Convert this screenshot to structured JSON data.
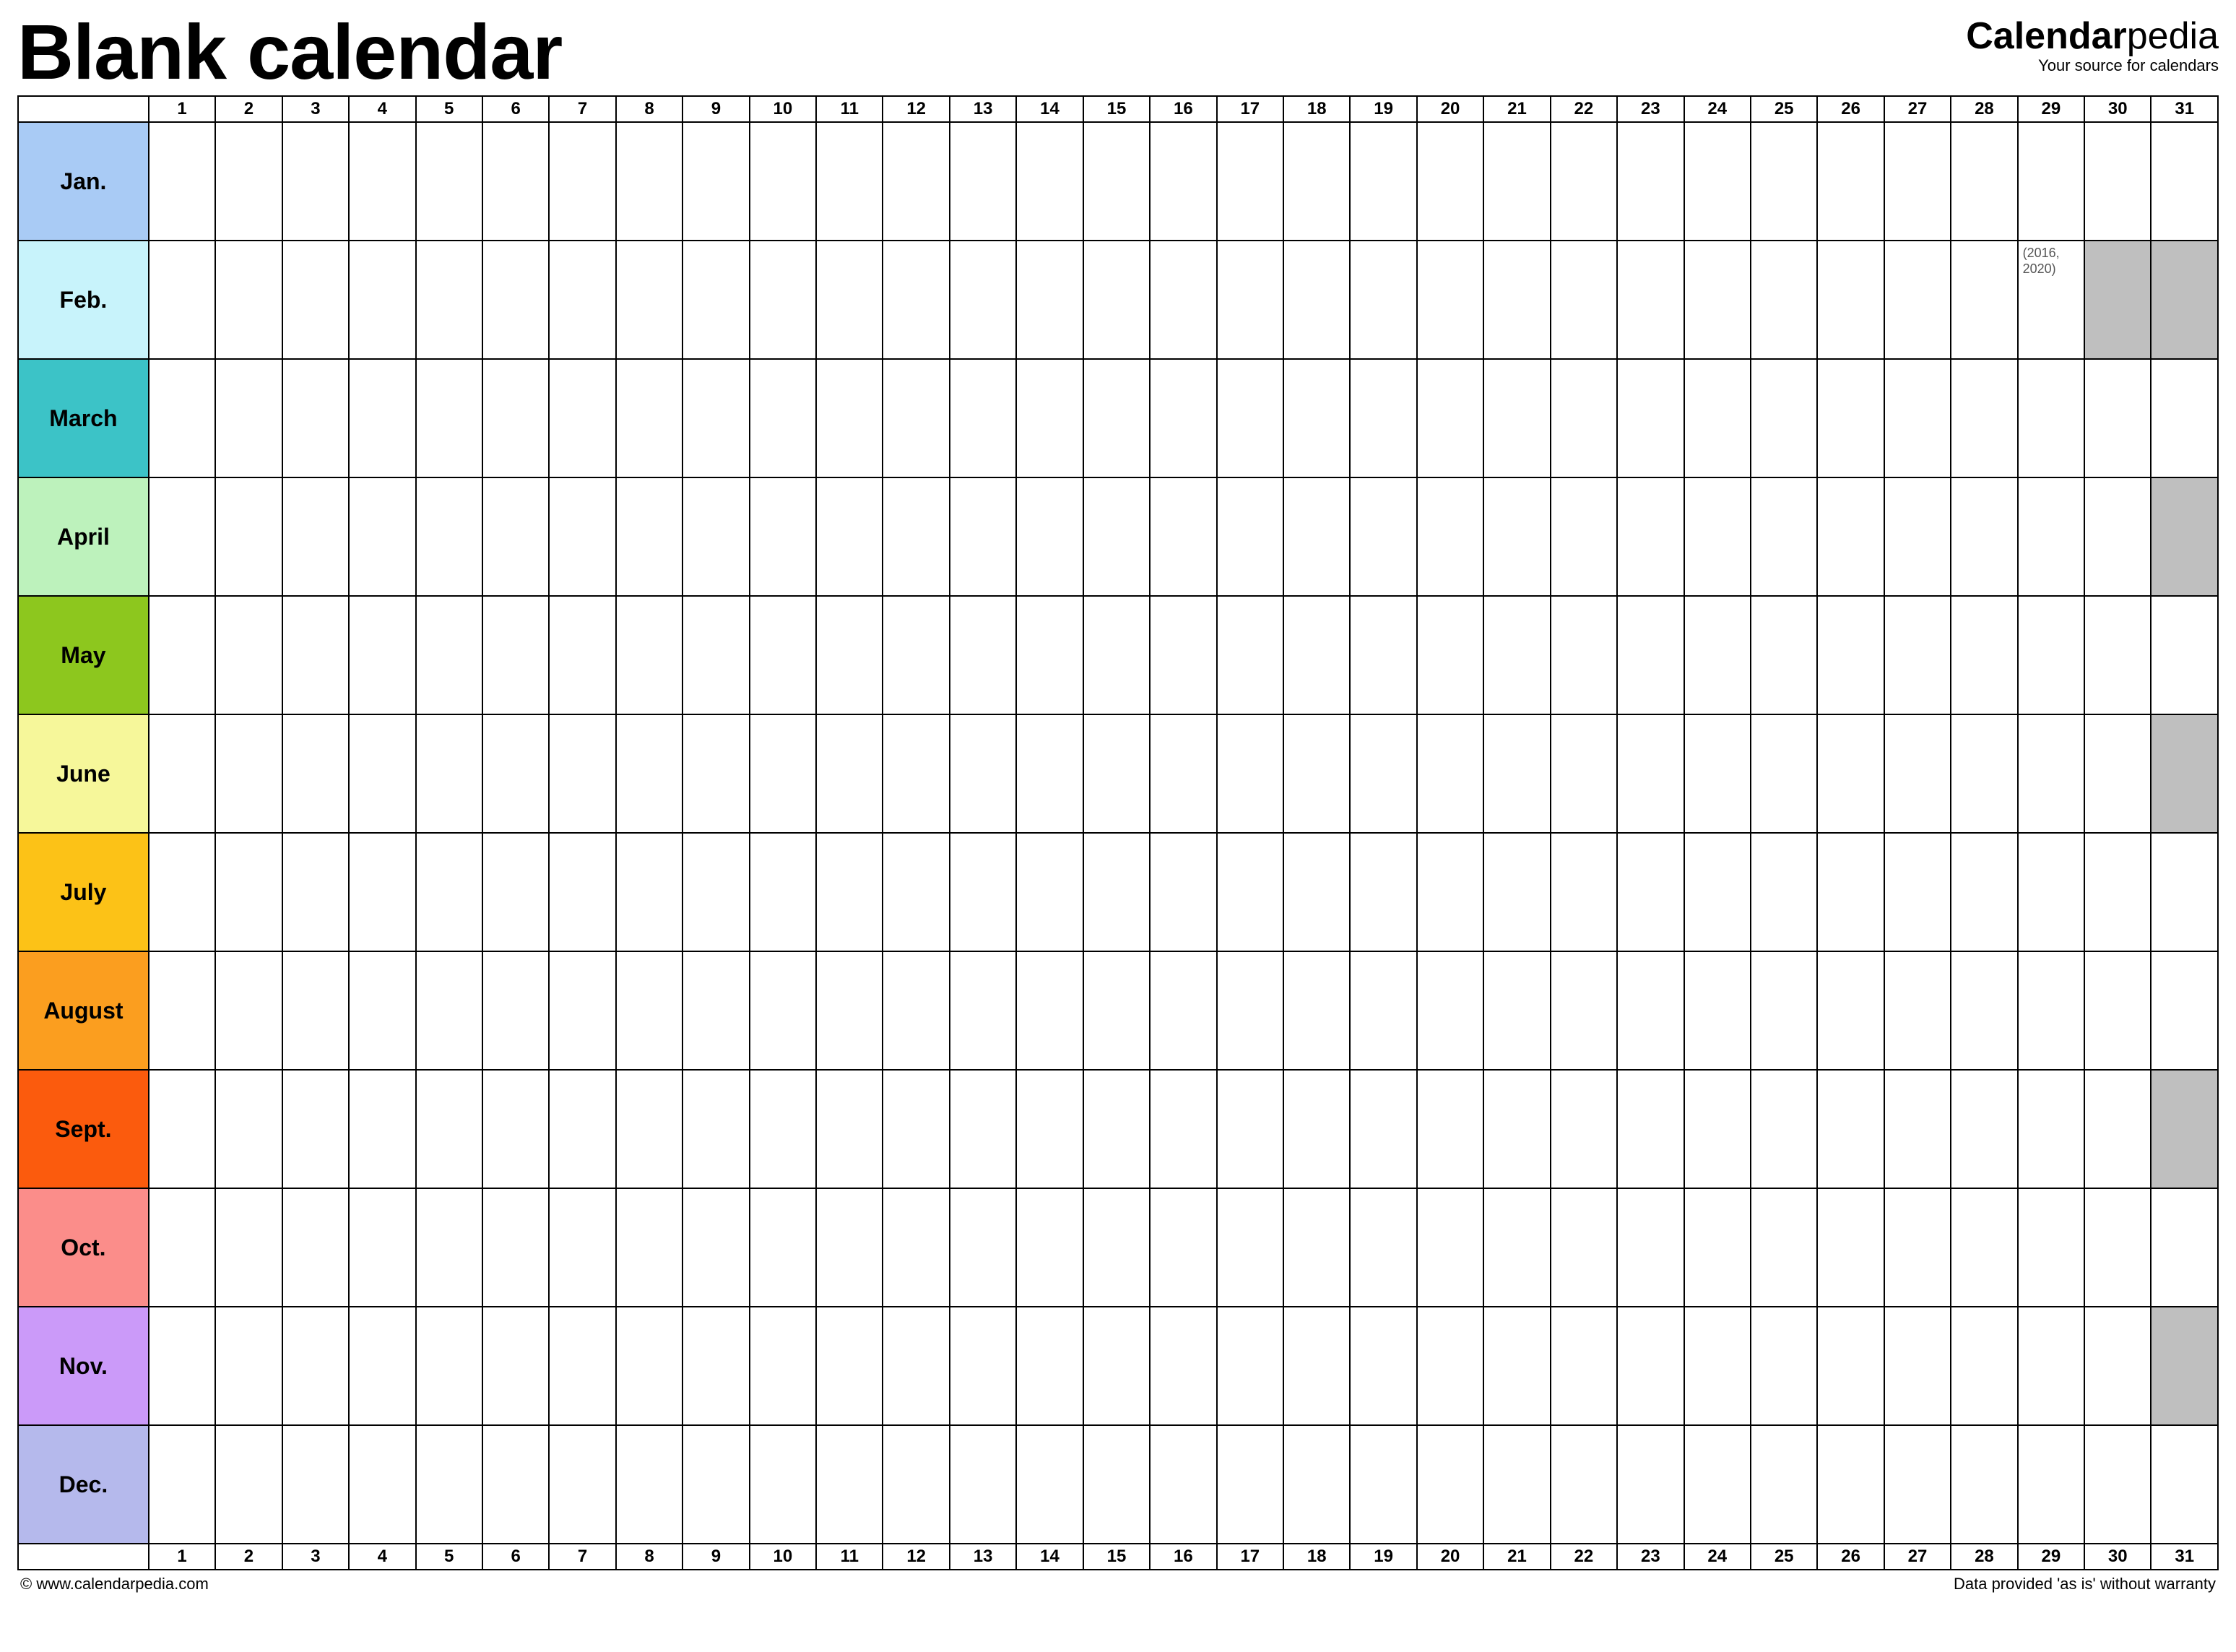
{
  "header": {
    "title": "Blank calendar",
    "brand_bold": "Calendar",
    "brand_rest": "pedia",
    "brand_tag": "Your source for calendars"
  },
  "days": [
    "1",
    "2",
    "3",
    "4",
    "5",
    "6",
    "7",
    "8",
    "9",
    "10",
    "11",
    "12",
    "13",
    "14",
    "15",
    "16",
    "17",
    "18",
    "19",
    "20",
    "21",
    "22",
    "23",
    "24",
    "25",
    "26",
    "27",
    "28",
    "29",
    "30",
    "31"
  ],
  "months": [
    {
      "name": "Jan.",
      "color": "#a9cbf5",
      "days": 31
    },
    {
      "name": "Feb.",
      "color": "#c8f3fb",
      "days": 29,
      "note_day": 29,
      "note": "(2016, 2020)"
    },
    {
      "name": "March",
      "color": "#3cc3c7",
      "days": 31
    },
    {
      "name": "April",
      "color": "#bdf2bc",
      "days": 30
    },
    {
      "name": "May",
      "color": "#8dc71e",
      "days": 31
    },
    {
      "name": "June",
      "color": "#f6f79a",
      "days": 30
    },
    {
      "name": "July",
      "color": "#fcc217",
      "days": 31
    },
    {
      "name": "August",
      "color": "#fb9e1f",
      "days": 31
    },
    {
      "name": "Sept.",
      "color": "#fb5b0d",
      "days": 30
    },
    {
      "name": "Oct.",
      "color": "#fb8d8a",
      "days": 31
    },
    {
      "name": "Nov.",
      "color": "#cb9af9",
      "days": 30
    },
    {
      "name": "Dec.",
      "color": "#b5b9ec",
      "days": 31
    }
  ],
  "footer": {
    "left": "© www.calendarpedia.com",
    "right": "Data provided 'as is' without warranty"
  }
}
